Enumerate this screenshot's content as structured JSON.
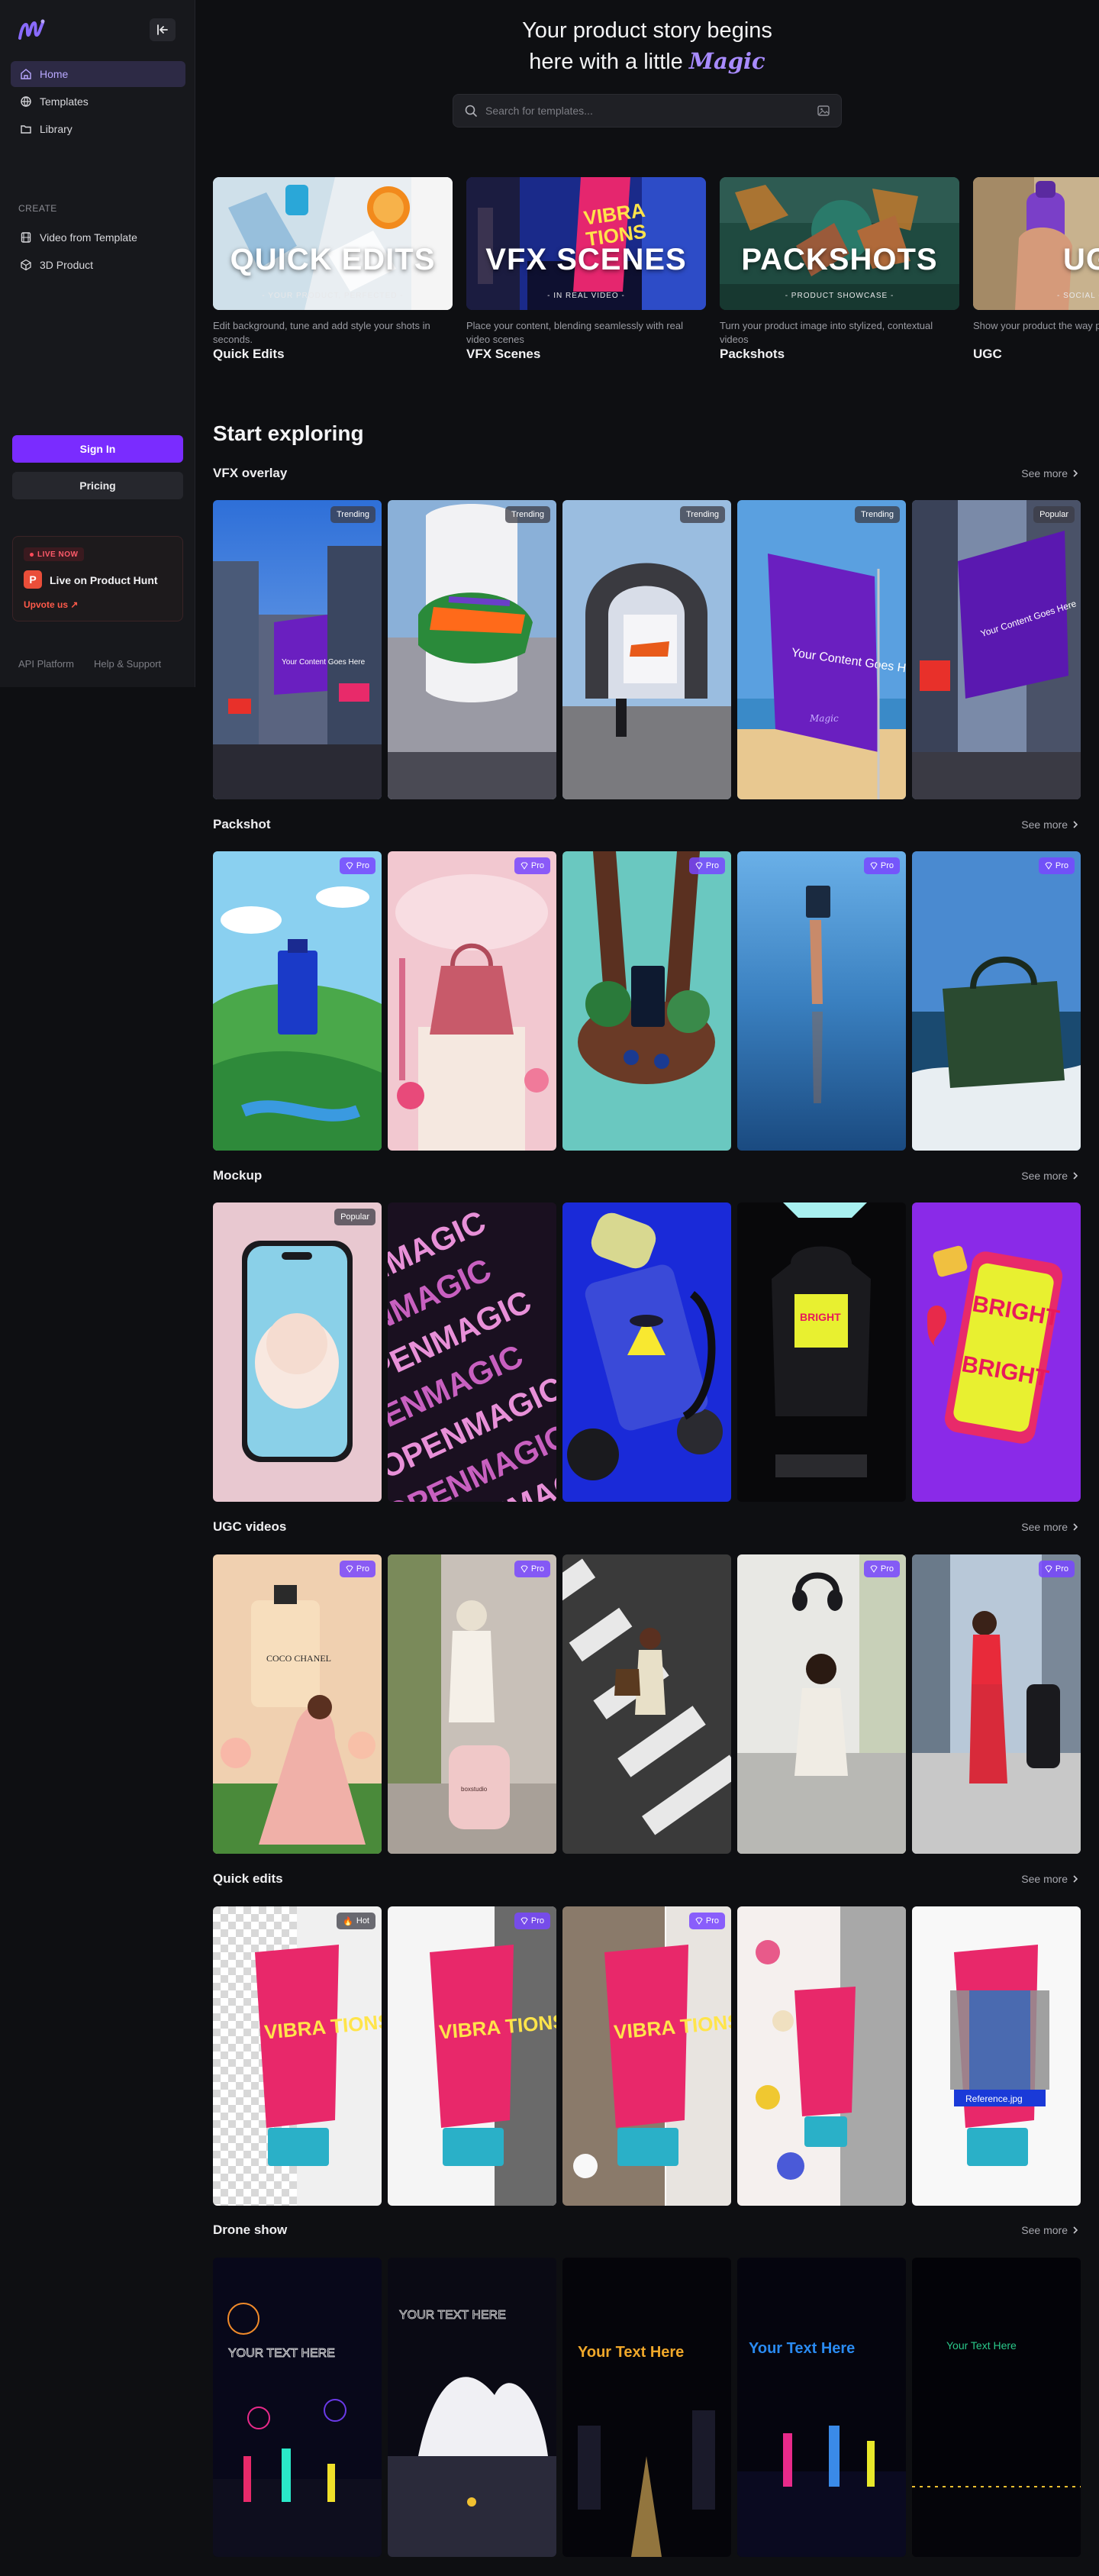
{
  "sidebar": {
    "logo_icon": "magic-logo-icon",
    "nav": [
      {
        "label": "Home",
        "icon": "home-icon",
        "active": true
      },
      {
        "label": "Templates",
        "icon": "globe-icon"
      },
      {
        "label": "Library",
        "icon": "folder-icon"
      }
    ],
    "create_label": "CREATE",
    "create": [
      {
        "label": "Video from Template",
        "icon": "film-icon"
      },
      {
        "label": "3D Product",
        "icon": "cube-icon"
      }
    ],
    "sign_in": "Sign In",
    "pricing": "Pricing",
    "product_hunt": {
      "live": "LIVE NOW",
      "title": "Live on Product Hunt",
      "upvote": "Upvote us ↗",
      "logo": "P"
    },
    "footer": [
      "API Platform",
      "Help & Support"
    ]
  },
  "hero": {
    "line1": "Your product story begins",
    "line2": "here with a little",
    "magic": "Magic"
  },
  "search": {
    "placeholder": "Search for templates..."
  },
  "features": [
    {
      "big": "QUICK EDITS",
      "small": "- YOUR PRODUCT, PERFECTED -",
      "desc": "Edit background, tune and add style your shots in seconds.",
      "name": "Quick Edits"
    },
    {
      "big": "VFX SCENES",
      "small": "- IN REAL VIDEO -",
      "desc": "Place your content, blending seamlessly with real video scenes",
      "name": "VFX Scenes"
    },
    {
      "big": "PACKSHOTS",
      "small": "- PRODUCT SHOWCASE -",
      "desc": "Turn your product image into stylized, contextual videos",
      "name": "Packshots"
    },
    {
      "big": "UGC",
      "small": "- SOCIAL -",
      "desc": "Show your product the way people share content",
      "name": "UGC"
    }
  ],
  "start_exploring": "Start exploring",
  "see_more": "See more",
  "rows": [
    {
      "title": "VFX overlay",
      "badges": [
        "Trending",
        "Trending",
        "Trending",
        "Trending",
        "Popular"
      ]
    },
    {
      "title": "Packshot",
      "badges": [
        "Pro",
        "Pro",
        "Pro",
        "Pro",
        "Pro"
      ]
    },
    {
      "title": "Mockup",
      "badges": [
        "Popular",
        "",
        "",
        "",
        ""
      ]
    },
    {
      "title": "UGC videos",
      "badges": [
        "Pro",
        "Pro",
        "",
        "Pro",
        "Pro"
      ]
    },
    {
      "title": "Quick edits",
      "badges": [
        "Hot",
        "Pro",
        "Pro",
        "",
        ""
      ]
    },
    {
      "title": "Drone show",
      "badges": [
        "",
        "",
        "",
        "",
        ""
      ]
    }
  ],
  "tile_text": {
    "vfx_content": "Your Content Goes Here",
    "magic_mark": "Magic",
    "mockup_word": "OPENMAGIC",
    "mockup_bright": "BRIGHT",
    "perfume_label": "COCO CHANEL",
    "tube_brand": "VIBRA TIONS",
    "reference": "Reference.jpg",
    "drone_text": "YOUR TEXT HERE",
    "drone_text2": "Your Text Here"
  },
  "colors": {
    "accent": "#7a2cff",
    "brand_text": "#a88bff",
    "background": "#0e0f12",
    "sidebar": "#17181c"
  }
}
